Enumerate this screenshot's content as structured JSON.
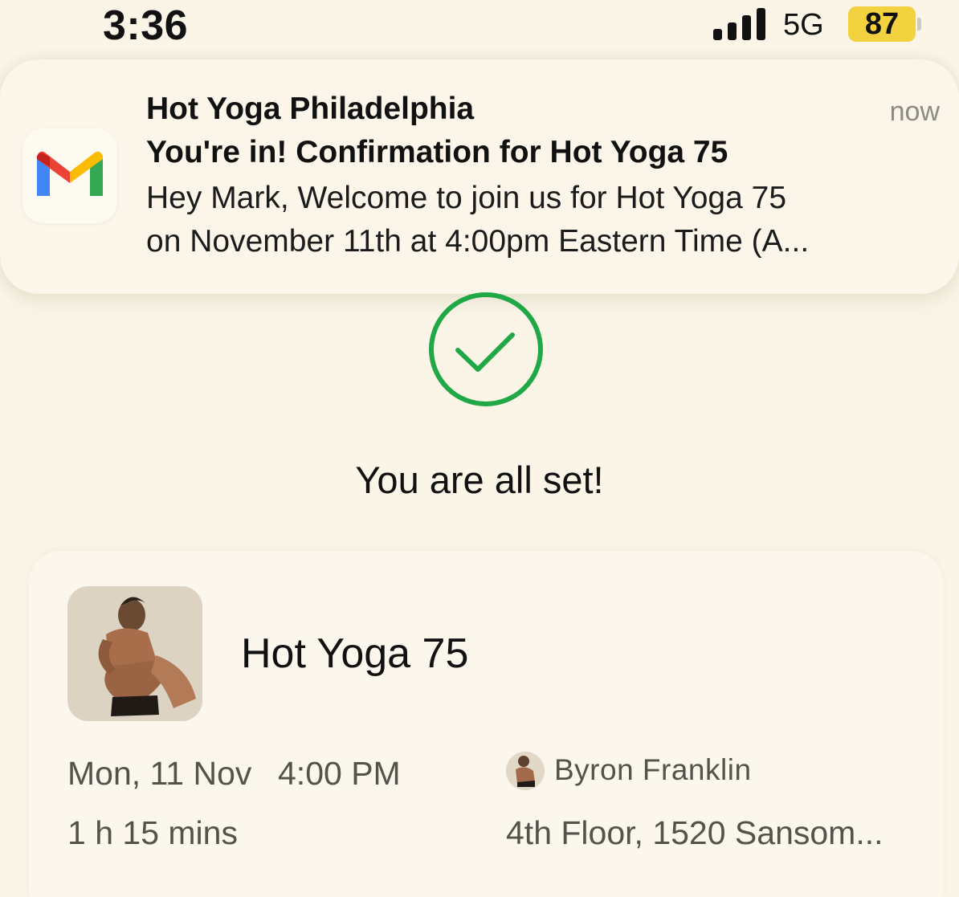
{
  "status_bar": {
    "time": "3:36",
    "network": "5G",
    "battery": "87",
    "battery_color": "#f2d23e",
    "signal_icon": "cellular-signal-icon"
  },
  "notification": {
    "app_icon": "gmail-icon",
    "sender": "Hot Yoga Philadelphia",
    "time": "now",
    "subject": "You're in! Confirmation for Hot Yoga 75",
    "body_line1": "Hey Mark, Welcome to join us for Hot Yoga 75",
    "body_line2": "on November 11th at 4:00pm Eastern Time (A..."
  },
  "confirmation": {
    "icon": "check-circle-icon",
    "icon_color": "#1fa845",
    "message": "You are all set!"
  },
  "class_card": {
    "thumbnail": "yoga-pose-photo",
    "name": "Hot Yoga 75",
    "date": "Mon, 11 Nov",
    "time": "4:00 PM",
    "duration": "1 h 15 mins",
    "instructor": "Byron Franklin",
    "location": "4th Floor, 1520 Sansom..."
  }
}
